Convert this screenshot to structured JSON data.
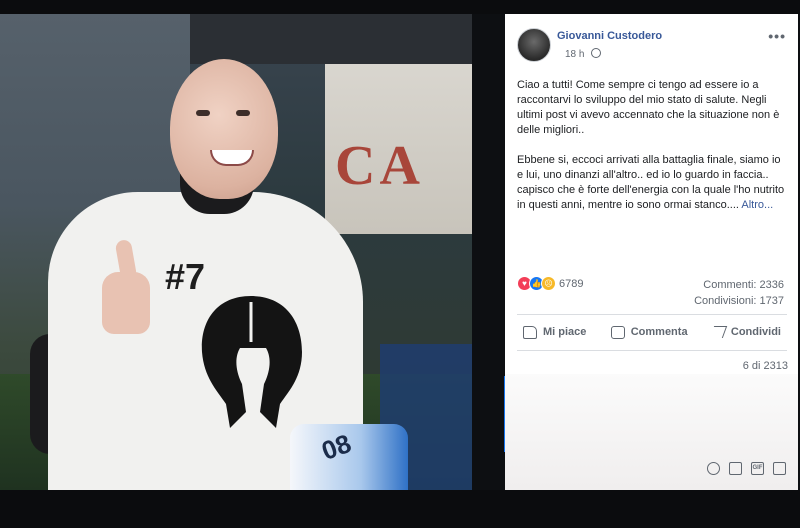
{
  "post": {
    "author": "Giovanni Custodero",
    "time": "18 h",
    "paragraphs": [
      "Ciao a tutti! Come sempre ci tengo ad essere io a raccontarvi lo sviluppo del mio stato di salute. Negli ultimi post vi avevo accennato che la situazione non è delle migliori..",
      "Ebbene si, eccoci arrivati alla battaglia finale, siamo io e lui, uno dinanzi all'altro.. ed io lo guardo in faccia.. capisco che è forte dell'energia con la quale l'ho nutrito in questi anni, mentre io sono ormai stanco...."
    ],
    "more_link": "Altro...",
    "reaction_count": "6789",
    "comments_label": "Commenti: 2336",
    "shares_label": "Condivisioni: 1737",
    "actions": {
      "like": "Mi piace",
      "comment": "Comment",
      "comment_full": "Commenta",
      "share": "Condividi"
    },
    "photo_counter": "6 di 2313"
  },
  "photo": {
    "shirt_number": "#7",
    "jersey_number": "08",
    "banner_text": "CA"
  },
  "icons": {
    "reactions": [
      "love-icon",
      "like-icon",
      "sad-icon"
    ],
    "comment_tools": [
      "emoji-icon",
      "camera-icon",
      "gif-icon",
      "sticker-icon"
    ]
  },
  "colors": {
    "link": "#385898",
    "background": "#0d0f12"
  }
}
